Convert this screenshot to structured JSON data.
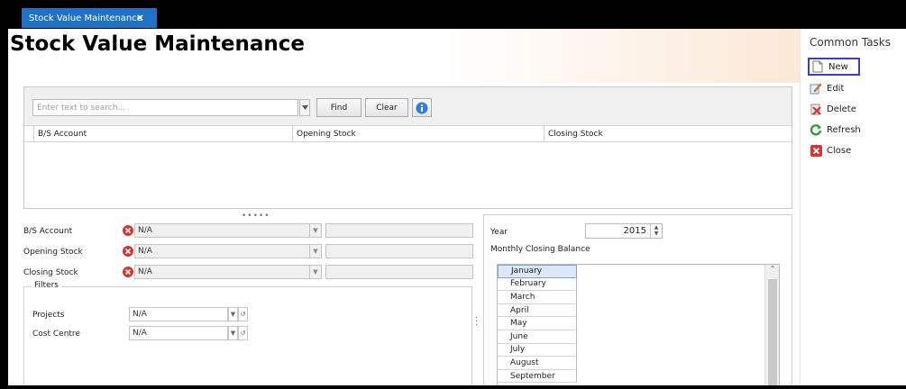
{
  "tab": {
    "title": "Stock Value Maintenance",
    "close": "×"
  },
  "page": {
    "title": "Stock Value Maintenance"
  },
  "sidebar": {
    "title": "Common Tasks",
    "items": [
      {
        "label": "New",
        "icon": "new-document-icon"
      },
      {
        "label": "Edit",
        "icon": "edit-icon"
      },
      {
        "label": "Delete",
        "icon": "delete-icon"
      },
      {
        "label": "Refresh",
        "icon": "refresh-icon"
      },
      {
        "label": "Close",
        "icon": "close-icon"
      }
    ]
  },
  "search": {
    "placeholder": "Enter text to search...",
    "find_label": "Find",
    "clear_label": "Clear"
  },
  "grid": {
    "columns": [
      "B/S Account",
      "Opening Stock",
      "Closing Stock"
    ]
  },
  "form": {
    "bs_account_label": "B/S Account",
    "bs_account_value": "N/A",
    "opening_stock_label": "Opening Stock",
    "opening_stock_value": "N/A",
    "closing_stock_label": "Closing Stock",
    "closing_stock_value": "N/A"
  },
  "filters": {
    "legend": "Filters",
    "projects_label": "Projects",
    "projects_value": "N/A",
    "cost_centre_label": "Cost Centre",
    "cost_centre_value": "N/A"
  },
  "right": {
    "year_label": "Year",
    "year_value": "2015",
    "monthly_label": "Monthly Closing Balance",
    "months": [
      "January",
      "February",
      "March",
      "April",
      "May",
      "June",
      "July",
      "August",
      "September"
    ]
  },
  "colors": {
    "tab": "#1e73c6",
    "highlight": "#3c3cd0",
    "error": "#d9342b"
  }
}
